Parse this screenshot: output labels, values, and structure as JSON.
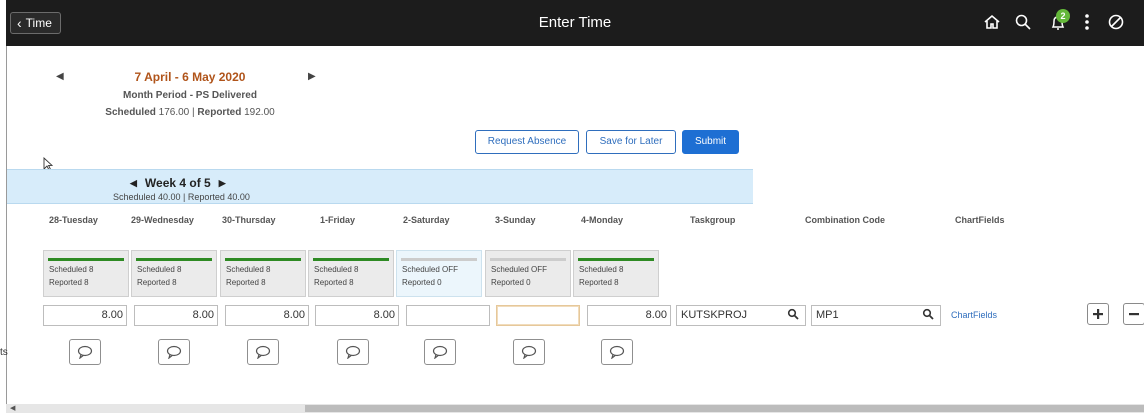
{
  "header": {
    "back_label": "Time",
    "title": "Enter Time",
    "notification_count": "2",
    "icons": [
      "home-icon",
      "search-icon",
      "notifications-icon",
      "more-icon",
      "navbar-icon"
    ]
  },
  "period": {
    "title": "7 April - 6 May 2020",
    "subtitle": "Month Period - PS Delivered",
    "scheduled_label": "Scheduled",
    "scheduled_value": "176.00",
    "separator": "|",
    "reported_label": "Reported",
    "reported_value": "192.00"
  },
  "actions": {
    "request_absence": "Request Absence",
    "save_for_later": "Save for Later",
    "submit": "Submit"
  },
  "week": {
    "label": "Week 4 of 5",
    "totals": "Scheduled 40.00 | Reported 40.00"
  },
  "columns": [
    "28-Tuesday",
    "29-Wednesday",
    "30-Thursday",
    "1-Friday",
    "2-Saturday",
    "3-Sunday",
    "4-Monday",
    "Taskgroup",
    "Combination Code",
    "ChartFields"
  ],
  "days": [
    {
      "scheduled": "Scheduled 8",
      "reported": "Reported  8",
      "hours": "8.00"
    },
    {
      "scheduled": "Scheduled 8",
      "reported": "Reported  8",
      "hours": "8.00"
    },
    {
      "scheduled": "Scheduled 8",
      "reported": "Reported  8",
      "hours": "8.00"
    },
    {
      "scheduled": "Scheduled 8",
      "reported": "Reported  8",
      "hours": "8.00"
    },
    {
      "scheduled": "Scheduled OFF",
      "reported": "Reported  0",
      "hours": ""
    },
    {
      "scheduled": "Scheduled OFF",
      "reported": "Reported  0",
      "hours": ""
    },
    {
      "scheduled": "Scheduled 8",
      "reported": "Reported  8",
      "hours": "8.00"
    }
  ],
  "row": {
    "taskgroup": "KUTSKPROJ",
    "combination_code": "MP1",
    "chartfields_link": "ChartFields",
    "comments_label": "ts"
  },
  "colors": {
    "header_bg": "#1c1c1c",
    "period_title": "#b0541a",
    "primary": "#1e6fd3",
    "week_band": "#d7ecfa",
    "scheduled_bar": "#2e8a23"
  }
}
